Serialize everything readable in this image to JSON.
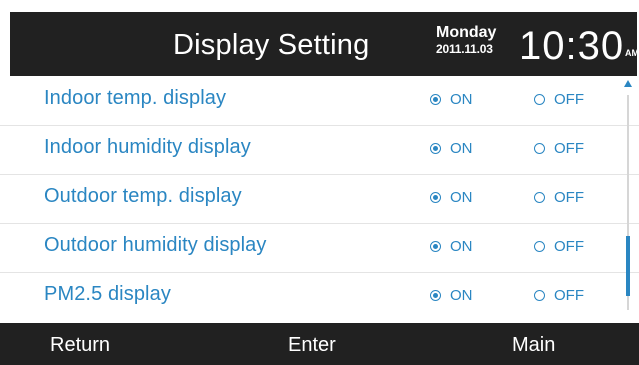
{
  "colors": {
    "accent": "#2a86c2",
    "header_bg": "#212121",
    "text_light": "#ffffff"
  },
  "header": {
    "title": "Display Setting",
    "day": "Monday",
    "date": "2011.11.03",
    "time": "10:30",
    "ampm": "AM"
  },
  "settings": [
    {
      "label": "Indoor temp. display",
      "on_label": "ON",
      "off_label": "OFF",
      "selected": "ON"
    },
    {
      "label": "Indoor humidity display",
      "on_label": "ON",
      "off_label": "OFF",
      "selected": "ON"
    },
    {
      "label": "Outdoor temp. display",
      "on_label": "ON",
      "off_label": "OFF",
      "selected": "ON"
    },
    {
      "label": "Outdoor humidity display",
      "on_label": "ON",
      "off_label": "OFF",
      "selected": "ON"
    },
    {
      "label": "PM2.5 display",
      "on_label": "ON",
      "off_label": "OFF",
      "selected": "ON"
    }
  ],
  "scrollbar": {
    "up_icon": "up-arrow-icon"
  },
  "footer": {
    "return_label": "Return",
    "enter_label": "Enter",
    "main_label": "Main"
  }
}
